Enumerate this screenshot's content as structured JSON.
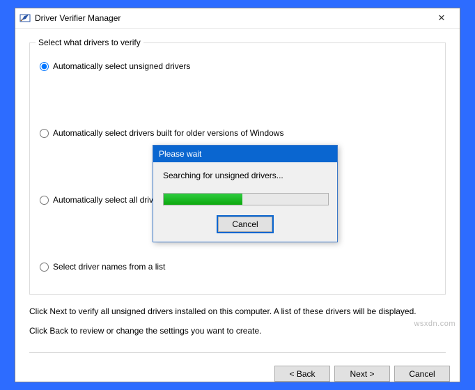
{
  "window": {
    "title": "Driver Verifier Manager",
    "close_glyph": "✕"
  },
  "group": {
    "label": "Select what drivers to verify",
    "options": {
      "auto_unsigned": "Automatically select unsigned drivers",
      "auto_older": "Automatically select drivers built for older versions of Windows",
      "auto_all": "Automatically select all drivers installed on this computer",
      "from_list": "Select driver names from a list"
    },
    "selected": "auto_unsigned"
  },
  "hints": {
    "line1": "Click Next to verify all unsigned drivers installed on this computer. A list of these drivers will be displayed.",
    "line2": "Click Back to review or change the settings you want to create."
  },
  "buttons": {
    "back": "< Back",
    "next": "Next >",
    "cancel": "Cancel"
  },
  "dialog": {
    "title": "Please wait",
    "message": "Searching for unsigned drivers...",
    "progress_percent": 48,
    "cancel": "Cancel"
  },
  "watermark": "wsxdn.com"
}
